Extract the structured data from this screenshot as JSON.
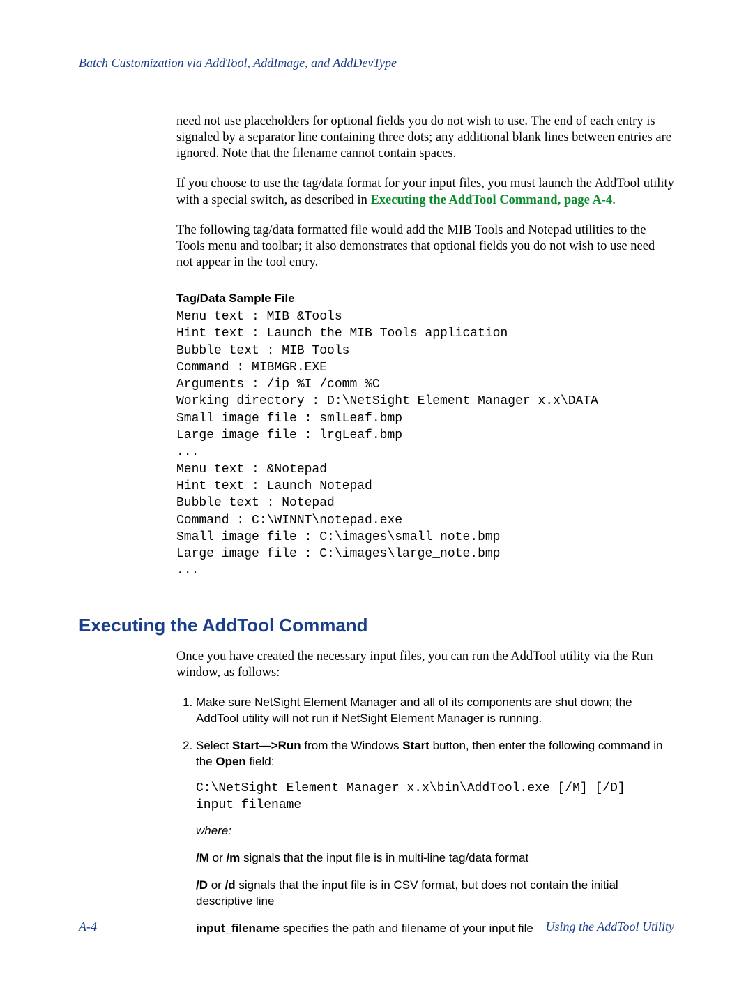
{
  "header": {
    "running_title": "Batch Customization via AddTool, AddImage, and AddDevType"
  },
  "body": {
    "para1": "need not use placeholders for optional fields you do not wish to use. The end of each entry is signaled by a separator line containing three dots; any additional blank lines between entries are ignored. Note that the filename cannot contain spaces.",
    "para2a": "If you choose to use the tag/data format for your input files, you must launch the AddTool utility with a special switch, as described in ",
    "para2_xref": "Executing the AddTool Command, page A-4",
    "para2b": ".",
    "para3": "The following tag/data formatted file would add the MIB Tools and Notepad utilities to the Tools menu and toolbar; it also demonstrates that optional fields you do not wish to use need not appear in the tool entry.",
    "sample_heading": "Tag/Data Sample File",
    "sample_code": "Menu text : MIB &Tools\nHint text : Launch the MIB Tools application\nBubble text : MIB Tools\nCommand : MIBMGR.EXE\nArguments : /ip %I /comm %C\nWorking directory : D:\\NetSight Element Manager x.x\\DATA\nSmall image file : smlLeaf.bmp\nLarge image file : lrgLeaf.bmp\n...\nMenu text : &Notepad\nHint text : Launch Notepad\nBubble text : Notepad\nCommand : C:\\WINNT\\notepad.exe\nSmall image file : C:\\images\\small_note.bmp\nLarge image file : C:\\images\\large_note.bmp\n..."
  },
  "section": {
    "title": "Executing the AddTool Command",
    "intro": "Once you have created the necessary input files, you can run the AddTool utility via the Run window, as follows:",
    "step1": "Make sure NetSight Element Manager and all of its components are shut down; the AddTool utility will not run if NetSight Element Manager is running.",
    "step2_a": "Select ",
    "step2_b1": "Start—>Run",
    "step2_c": " from the Windows ",
    "step2_b2": "Start",
    "step2_d": " button, then enter the following command in the ",
    "step2_b3": "Open",
    "step2_e": " field:",
    "command": "C:\\NetSight Element Manager x.x\\bin\\AddTool.exe [/M] [/D] input_filename",
    "where": "where:",
    "switch_M_b1": "/M",
    "switch_M_mid": " or ",
    "switch_M_b2": "/m",
    "switch_M_tail": " signals that the input file is in multi-line tag/data format",
    "switch_D_b1": "/D",
    "switch_D_mid": " or ",
    "switch_D_b2": "/d",
    "switch_D_tail": " signals that the input file is in CSV format, but does not contain the initial descriptive line",
    "switch_in_b": "input_filename",
    "switch_in_tail": " specifies the path and filename of your input file"
  },
  "footer": {
    "page_num": "A-4",
    "doc_title": "Using the AddTool Utility"
  }
}
